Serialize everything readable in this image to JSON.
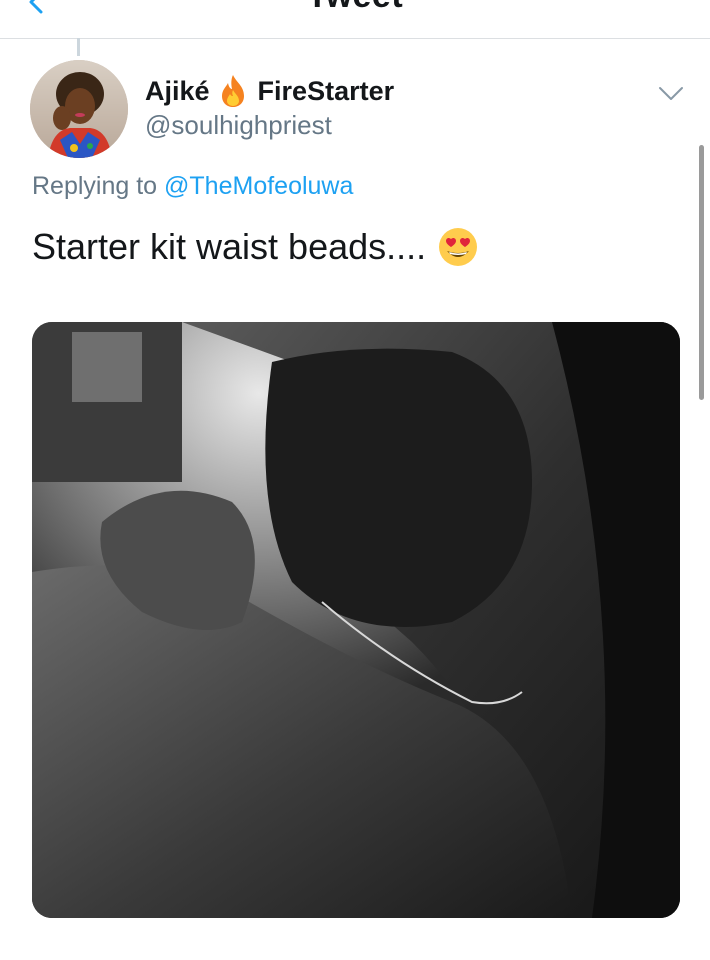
{
  "nav": {
    "title": "Tweet"
  },
  "tweet": {
    "author_name_first": "Ajiké",
    "author_name_emoji": "fire-icon",
    "author_name_second": "FireStarter",
    "handle": "@soulhighpriest",
    "replying_prefix": "Replying to",
    "replying_mention": "@TheMofeoluwa",
    "text": "Starter kit waist beads....",
    "text_emoji": "heart-eyes-emoji"
  },
  "colors": {
    "link": "#1da1f2",
    "secondary_text": "#657786",
    "primary_text": "#14171a",
    "divider": "#dcdfe2",
    "nav_back": "#1da1f2"
  },
  "icons": {
    "back": "chevron-left-icon",
    "more": "chevron-down-icon"
  }
}
